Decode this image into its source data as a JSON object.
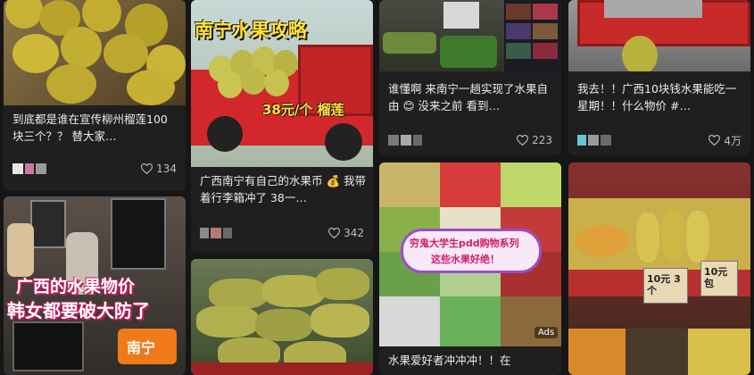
{
  "cards": [
    {
      "id": "c1",
      "title": "到底都是谁在宣传柳州榴莲100块三个？？ 替大家…",
      "likes": "134"
    },
    {
      "id": "c2",
      "title": "广西南宁有自己的水果币 💰 我带着行李箱冲了 38一…",
      "likes": "342",
      "overlay": "南宁水果攻略",
      "price": "38元/个 榴莲"
    },
    {
      "id": "c3",
      "title": "谁懂啊 来南宁一趟实现了水果自由 😊 没来之前 看到…",
      "likes": "223"
    },
    {
      "id": "c4",
      "title": "我去！！广西10块钱水果能吃一星期！！什么物价 #…",
      "likes": "4万"
    },
    {
      "id": "c5",
      "title": "",
      "likes": "",
      "overlay1": "广西的水果物价",
      "overlay2": "韩女都要破大防了",
      "badge": "南宁"
    },
    {
      "id": "c6",
      "title": "",
      "likes": ""
    },
    {
      "id": "c7",
      "title": "水果爱好者冲冲冲！！在",
      "likes": "",
      "bubble1": "穷鬼大学生pdd购物系列",
      "bubble2": "这些水果好绝！",
      "ads": "Ads"
    },
    {
      "id": "c8",
      "title": "",
      "likes": "",
      "tag1": "10元 3个",
      "tag2": "10元 包"
    }
  ]
}
